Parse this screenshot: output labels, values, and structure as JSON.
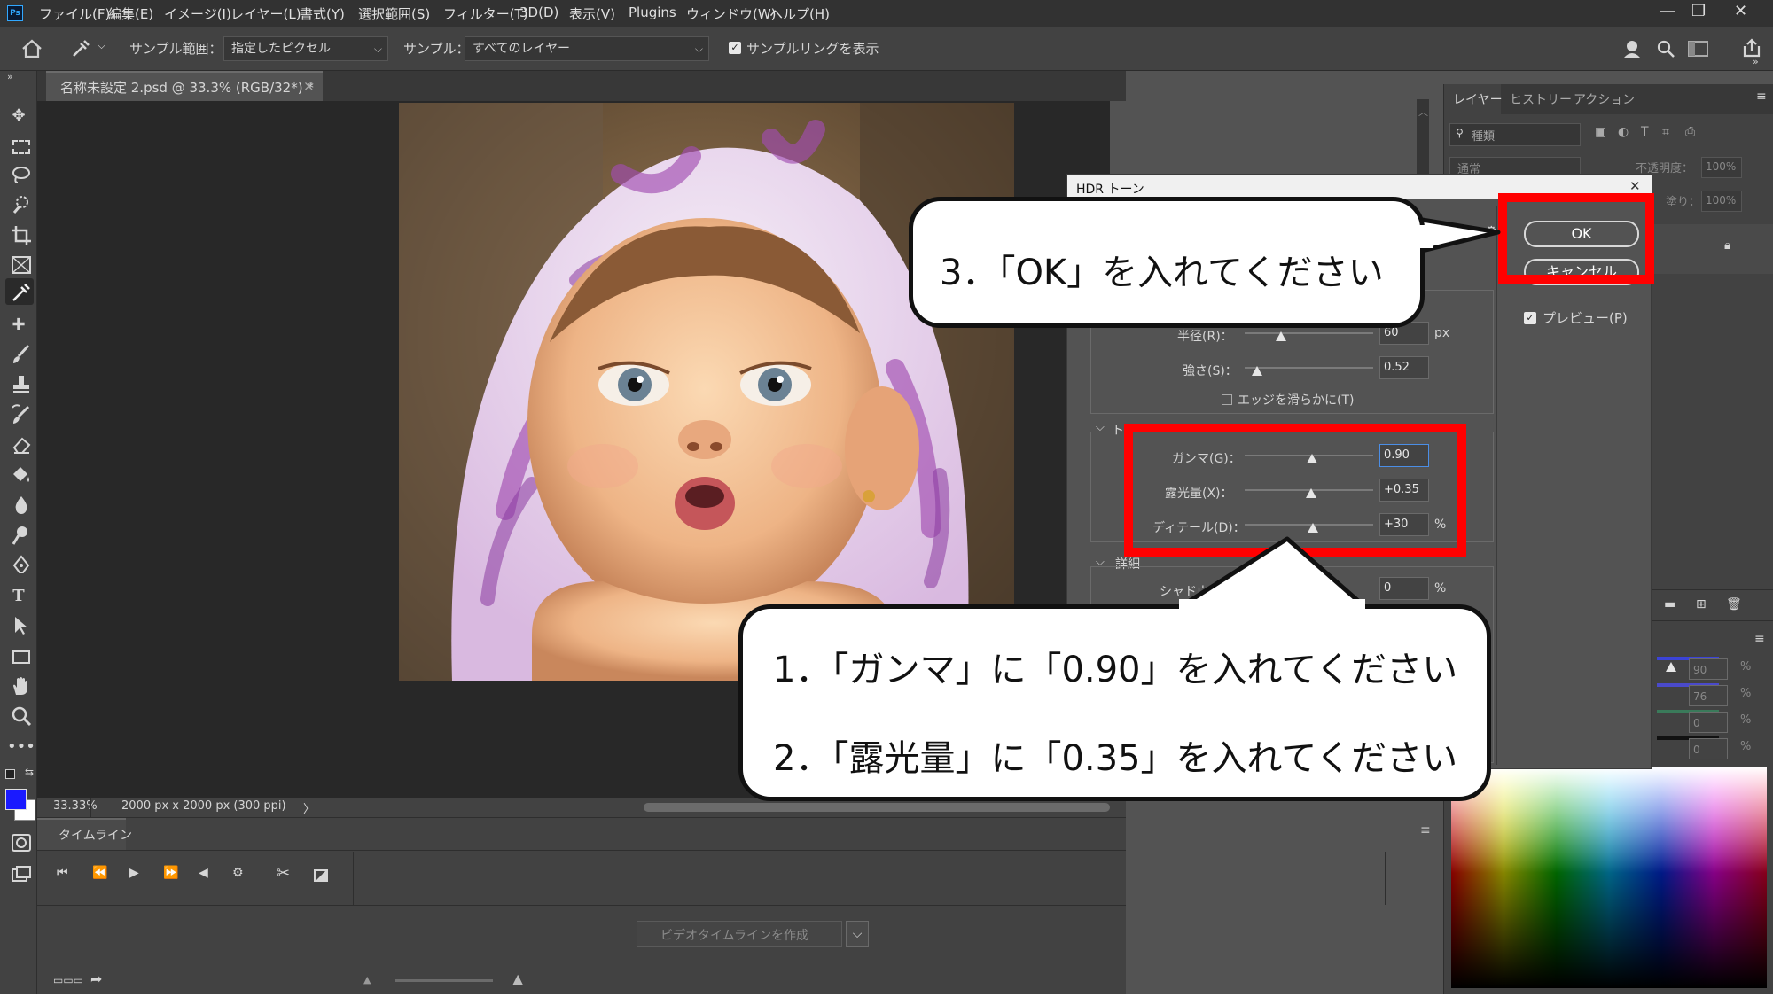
{
  "menubar": {
    "logo": "Ps",
    "items": [
      "ファイル(F)",
      "編集(E)",
      "イメージ(I)",
      "レイヤー(L)",
      "書式(Y)",
      "選択範囲(S)",
      "フィルター(T)",
      "3D(D)",
      "表示(V)",
      "Plugins",
      "ウィンドウ(W)",
      "ヘルプ(H)"
    ],
    "window_controls": [
      "—",
      "❐",
      "✕"
    ]
  },
  "options_bar": {
    "sample_size_label": "サンプル範囲：",
    "sample_size_value": "指定したピクセル",
    "sample_label": "サンプル：",
    "sample_value": "すべてのレイヤー",
    "show_ring_label": "サンプルリングを表示"
  },
  "document": {
    "tab_title": "名称未設定 2.psd @ 33.3% (RGB/32*) *",
    "tab_close": "×"
  },
  "status_bar": {
    "zoom": "33.33%",
    "dimensions": "2000 px x 2000 px (300 ppi)",
    "arrow": "〉"
  },
  "timeline": {
    "tab_label": "タイムライン",
    "create_button": "ビデオタイムラインを作成"
  },
  "right_panel": {
    "tabs": [
      "レイヤー",
      "ヒストリー",
      "アクション"
    ],
    "filter_placeholder": "種類",
    "blend_mode": "通常",
    "opacity_label": "不透明度：",
    "opacity_value": "100%",
    "fill_label": "塗り：",
    "fill_value": "100%",
    "color_values": [
      "90",
      "76",
      "0",
      "0"
    ],
    "percent": "%"
  },
  "dialog": {
    "title": "HDR トーン",
    "ok_label": "OK",
    "cancel_label": "キャンセル",
    "preview_label": "プレビュー(P)",
    "radius_label": "半径(R)：",
    "radius_value": "60",
    "radius_unit": "px",
    "strength_label": "強さ(S)：",
    "strength_value": "0.52",
    "smooth_edges_label": "エッジを滑らかに(T)",
    "tone_section": "ト",
    "gamma_label": "ガンマ(G)：",
    "gamma_value": "0.90",
    "exposure_label": "露光量(X)：",
    "exposure_value": "+0.35",
    "detail_label": "ディテール(D)：",
    "detail_value": "+30",
    "detail_unit": "%",
    "advanced_section": "詳細",
    "shadow_label": "シャドウ",
    "shadow_value": "0",
    "shadow_unit": "%"
  },
  "callouts": {
    "step3": "3．「OK」を入れてください",
    "step1": "1．「ガンマ」に「0.90」を入れてください",
    "step2": "2．「露光量」に「0.35」を入れてください"
  },
  "colors": {
    "foreground": "#1a1aff",
    "highlight": "#ff0000",
    "accent": "#31a8ff"
  }
}
